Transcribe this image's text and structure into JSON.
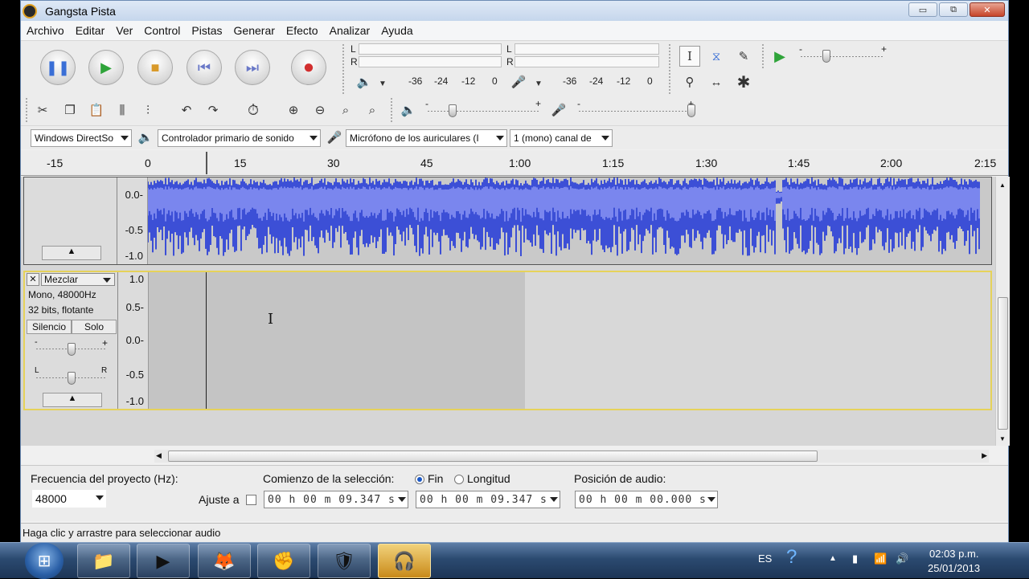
{
  "window": {
    "title": "Gangsta Pista"
  },
  "window_buttons": {
    "minimize": "▭",
    "restore": "⧉",
    "close": "✕"
  },
  "menu": [
    "Archivo",
    "Editar",
    "Ver",
    "Control",
    "Pistas",
    "Generar",
    "Efecto",
    "Analizar",
    "Ayuda"
  ],
  "meters": {
    "play": {
      "l": "L",
      "r": "R",
      "scale": [
        "-36",
        "-24",
        "-12",
        "0"
      ]
    },
    "record": {
      "l": "L",
      "r": "R",
      "scale": [
        "-36",
        "-24",
        "-12",
        "0"
      ]
    }
  },
  "playback_speed": {
    "minus": "-",
    "plus": "+"
  },
  "mixer": {
    "output_minus": "-",
    "output_plus": "+",
    "input_minus": "-",
    "input_plus": "+"
  },
  "devices": {
    "host": "Windows DirectSo",
    "output": "Controlador primario de sonido",
    "input": "Micrófono de los auriculares (I",
    "channels": "1 (mono) canal de"
  },
  "ruler": {
    "ticks": [
      "-15",
      "0",
      "15",
      "30",
      "45",
      "1:00",
      "1:15",
      "1:30",
      "1:45",
      "2:00",
      "2:15"
    ]
  },
  "track1": {
    "scale": [
      "0.0-",
      "-0.5",
      "-1.0"
    ],
    "play_fraction": 1.0
  },
  "track2": {
    "name": "Mezclar",
    "format": "Mono, 48000Hz",
    "bits": "32 bits, flotante",
    "mute": "Silencio",
    "solo": "Solo",
    "gain_minus": "-",
    "gain_plus": "+",
    "pan_l": "L",
    "pan_r": "R",
    "scale": [
      "1.0",
      "0.5-",
      "0.0-",
      "-0.5",
      "-1.0"
    ]
  },
  "selection_toolbar": {
    "rate_label": "Frecuencia del proyecto (Hz):",
    "rate_value": "48000",
    "snap_label": "Ajuste a",
    "sel_start_label": "Comienzo de la selección:",
    "end_label": "Fin",
    "length_label": "Longitud",
    "sel_start": "00 h 00 m 09.347 s",
    "sel_end": "00 h 00 m 09.347 s",
    "pos_label": "Posición de audio:",
    "pos": "00 h 00 m 00.000 s"
  },
  "status": "Haga clic y arrastre para seleccionar audio",
  "taskbar": {
    "lang": "ES",
    "time": "02:03 p.m.",
    "date": "25/01/2013"
  },
  "colors": {
    "waveform": "#3c4fd6",
    "waveform_rms": "#7a86ee",
    "selected_track_border": "#e6d25a"
  }
}
